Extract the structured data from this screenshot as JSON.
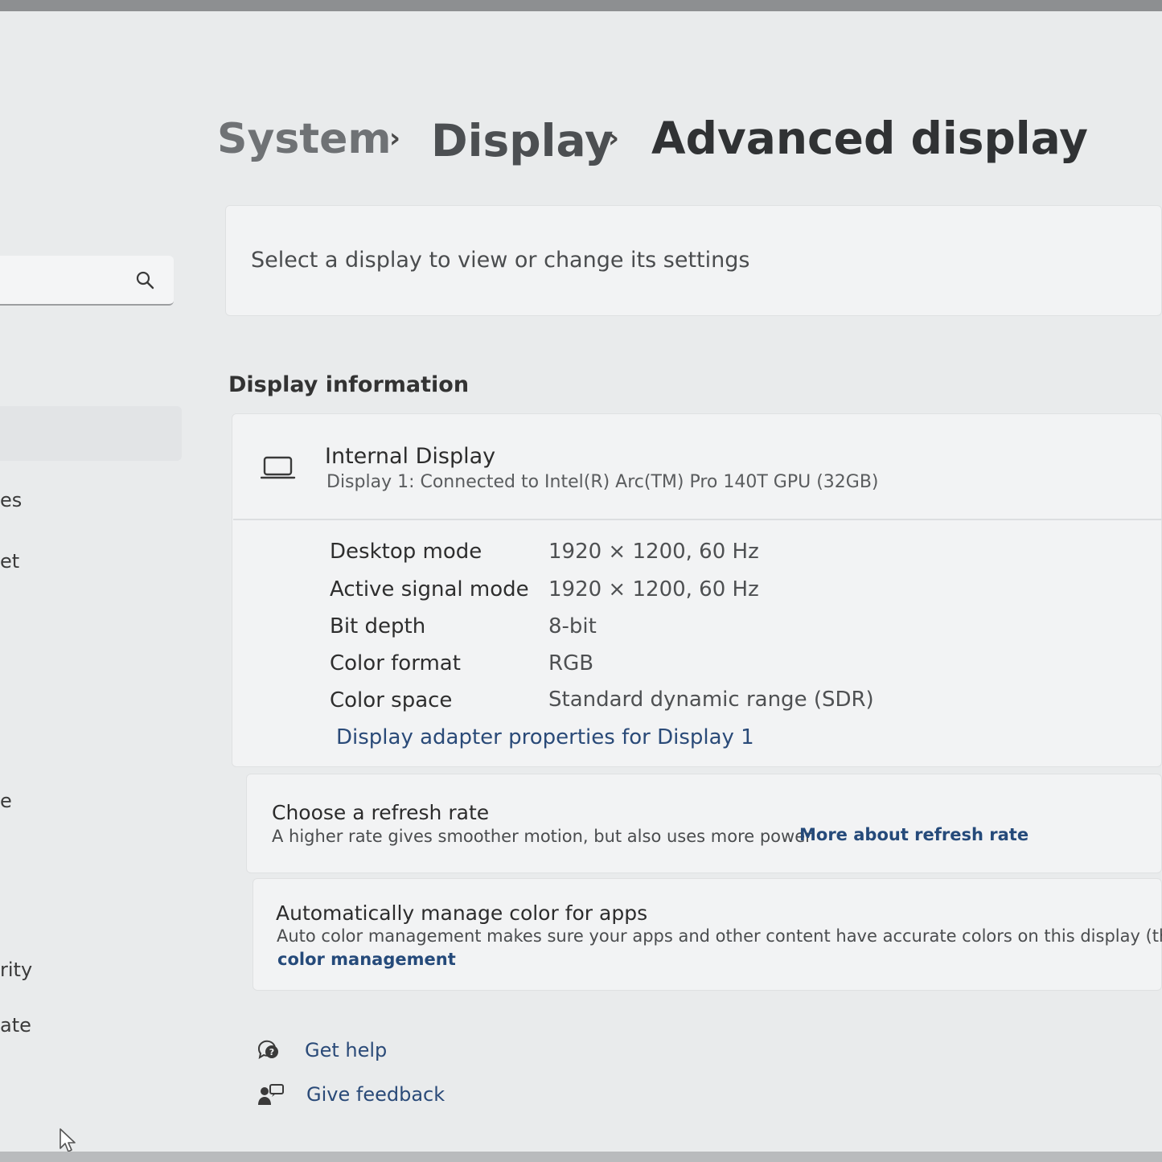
{
  "breadcrumb": {
    "items": [
      "System",
      "Display",
      "Advanced display"
    ],
    "separator": "›"
  },
  "sidebar": {
    "search_icon": "search-icon",
    "fragments": [
      "es",
      "et",
      "e",
      "rity",
      "ate"
    ]
  },
  "select_display": {
    "label": "Select a display to view or change its settings"
  },
  "display_information": {
    "section_title": "Display information",
    "display_name": "Internal Display",
    "display_sub": "Display 1: Connected to Intel(R) Arc(TM) Pro 140T GPU (32GB)",
    "icon": "laptop-icon",
    "rows": [
      {
        "label": "Desktop mode",
        "value": "1920 × 1200, 60 Hz"
      },
      {
        "label": "Active signal mode",
        "value": "1920 × 1200, 60 Hz"
      },
      {
        "label": "Bit depth",
        "value": "8-bit"
      },
      {
        "label": "Color format",
        "value": "RGB"
      },
      {
        "label": "Color space",
        "value": "Standard dynamic range (SDR)"
      }
    ],
    "adapter_link": "Display adapter properties for Display 1"
  },
  "refresh_rate": {
    "title": "Choose a refresh rate",
    "description": "A higher rate gives smoother motion, but also uses more power",
    "link": "More about refresh rate"
  },
  "color_management": {
    "title": "Automatically manage color for apps",
    "description": "Auto color management makes sure your apps and other content have accurate colors on this display (this may",
    "link": "color management"
  },
  "footer": {
    "get_help": "Get help",
    "give_feedback": "Give feedback"
  },
  "colors": {
    "link": "#2a4a78",
    "background": "#e9ebec",
    "card": "#f2f3f4"
  }
}
